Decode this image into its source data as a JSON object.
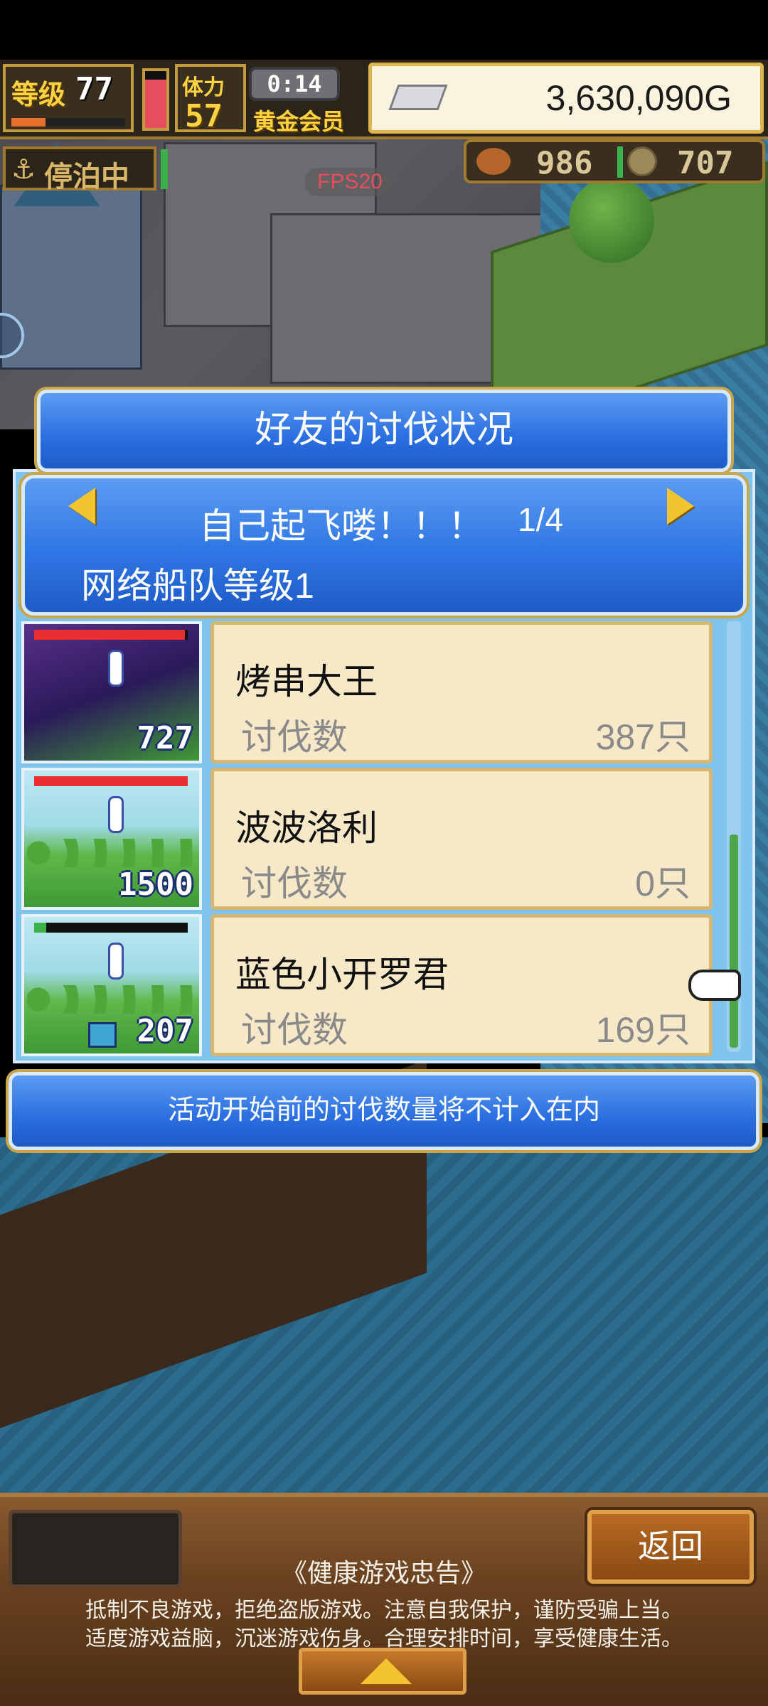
{
  "hud": {
    "level_label": "等级",
    "level_value": "77",
    "level_progress": 0.3,
    "stamina_label": "体力",
    "stamina_value": "57",
    "stamina_fill": 0.85,
    "timer": "0:14",
    "member_label": "黄金会员",
    "gold": "3,630,090G",
    "anchor_icon": "anchor-icon",
    "anchor_label": "停泊中",
    "fps": "FPS20",
    "resource_a": "986",
    "resource_b": "707"
  },
  "dialog": {
    "title": "好友的讨伐状况",
    "friend_name": "自己起飞喽！！！",
    "page": "1/4",
    "fleet_rank": "网络船队等级1",
    "notice": "活动开始前的讨伐数量将不计入在内"
  },
  "entries": [
    {
      "monster_count": "727",
      "hp_color": "#e83030",
      "hp_fill": 0.98,
      "name": "烤串大王",
      "label": "讨伐数",
      "value": "387只"
    },
    {
      "monster_count": "1500",
      "hp_color": "#e83030",
      "hp_fill": 1.0,
      "name": "波波洛利",
      "label": "讨伐数",
      "value": "0只"
    },
    {
      "monster_count": "207",
      "hp_color": "#3bb34a",
      "hp_fill": 0.08,
      "name": "蓝色小开罗君",
      "label": "讨伐数",
      "value": "169只"
    }
  ],
  "footer": {
    "back_label": "返回",
    "health_title": "《健康游戏忠告》",
    "health_line1": "抵制不良游戏，拒绝盗版游戏。注意自我保护，谨防受骗上当。",
    "health_line2": "适度游戏益脑，沉迷游戏伤身。合理安排时间，享受健康生活。"
  },
  "colors": {
    "panel_blue": "#2a6ee0",
    "card_bg": "#f7e8c8",
    "gold_accent": "#c9a54a"
  }
}
